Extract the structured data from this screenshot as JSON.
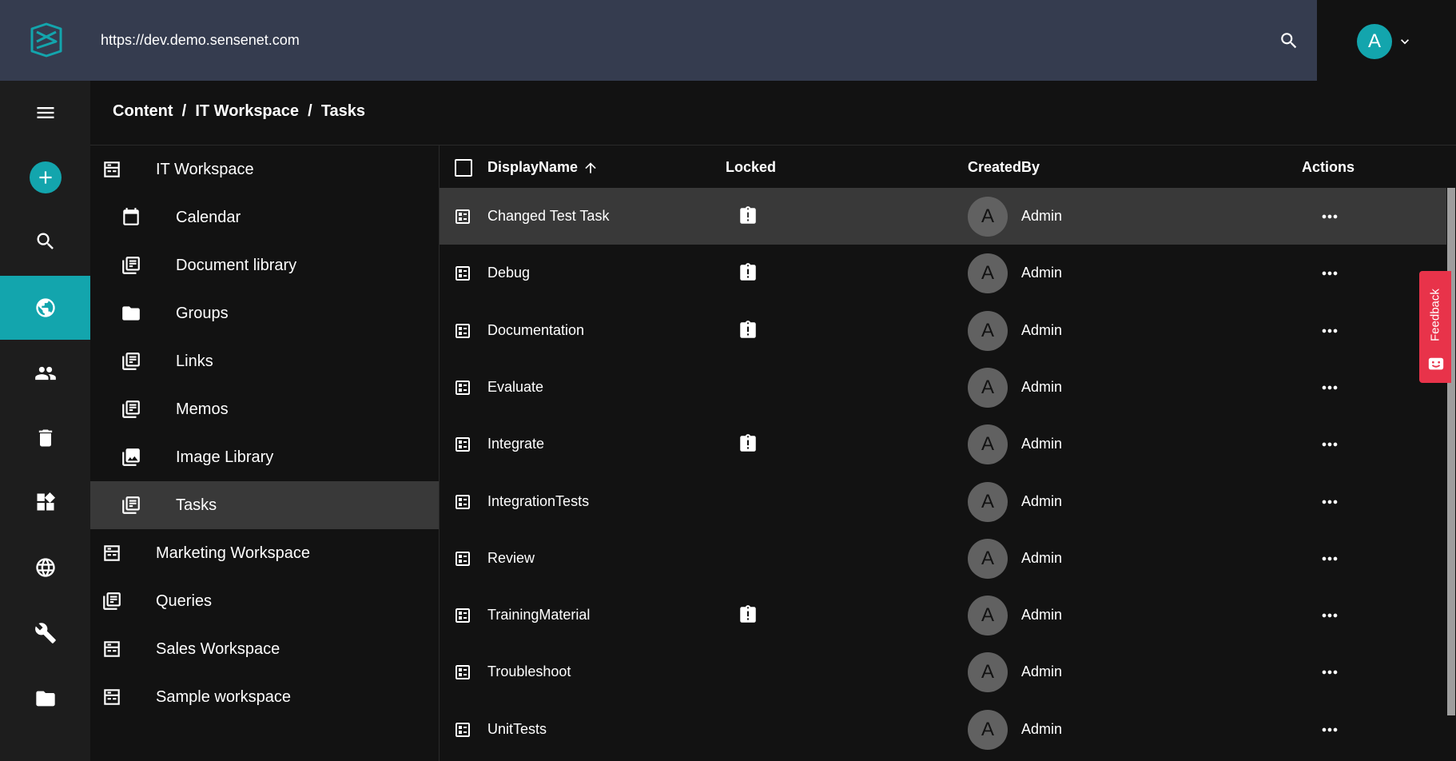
{
  "header": {
    "url": "https://dev.demo.sensenet.com",
    "user_initial": "A"
  },
  "breadcrumb": {
    "items": [
      "Content",
      "IT Workspace",
      "Tasks"
    ],
    "separator": "  /  "
  },
  "tree": {
    "items": [
      {
        "label": "IT Workspace",
        "icon": "workspace-icon",
        "indent": 0
      },
      {
        "label": "Calendar",
        "icon": "calendar-icon",
        "indent": 1
      },
      {
        "label": "Document library",
        "icon": "library-icon",
        "indent": 1
      },
      {
        "label": "Groups",
        "icon": "folder-icon",
        "indent": 1
      },
      {
        "label": "Links",
        "icon": "library-icon",
        "indent": 1
      },
      {
        "label": "Memos",
        "icon": "library-icon",
        "indent": 1
      },
      {
        "label": "Image Library",
        "icon": "image-library-icon",
        "indent": 1
      },
      {
        "label": "Tasks",
        "icon": "library-icon",
        "indent": 1,
        "selected": true
      },
      {
        "label": "Marketing Workspace",
        "icon": "workspace-icon",
        "indent": 0
      },
      {
        "label": "Queries",
        "icon": "library-icon",
        "indent": 0
      },
      {
        "label": "Sales Workspace",
        "icon": "workspace-icon",
        "indent": 0
      },
      {
        "label": "Sample workspace",
        "icon": "workspace-icon",
        "indent": 0
      }
    ]
  },
  "table": {
    "columns": {
      "displayname": "DisplayName",
      "locked": "Locked",
      "createdby": "CreatedBy",
      "actions": "Actions"
    },
    "rows": [
      {
        "name": "Changed Test Task",
        "locked": true,
        "creator": "Admin",
        "initial": "A"
      },
      {
        "name": "Debug",
        "locked": true,
        "creator": "Admin",
        "initial": "A"
      },
      {
        "name": "Documentation",
        "locked": true,
        "creator": "Admin",
        "initial": "A"
      },
      {
        "name": "Evaluate",
        "locked": false,
        "creator": "Admin",
        "initial": "A"
      },
      {
        "name": "Integrate",
        "locked": true,
        "creator": "Admin",
        "initial": "A"
      },
      {
        "name": "IntegrationTests",
        "locked": false,
        "creator": "Admin",
        "initial": "A"
      },
      {
        "name": "Review",
        "locked": false,
        "creator": "Admin",
        "initial": "A"
      },
      {
        "name": "TrainingMaterial",
        "locked": true,
        "creator": "Admin",
        "initial": "A"
      },
      {
        "name": "Troubleshoot",
        "locked": false,
        "creator": "Admin",
        "initial": "A"
      },
      {
        "name": "UnitTests",
        "locked": false,
        "creator": "Admin",
        "initial": "A"
      }
    ]
  },
  "feedback": {
    "label": "Feedback"
  },
  "colors": {
    "accent": "#13a5ad",
    "header_bg": "#353c4f",
    "feedback": "#e8334a"
  }
}
